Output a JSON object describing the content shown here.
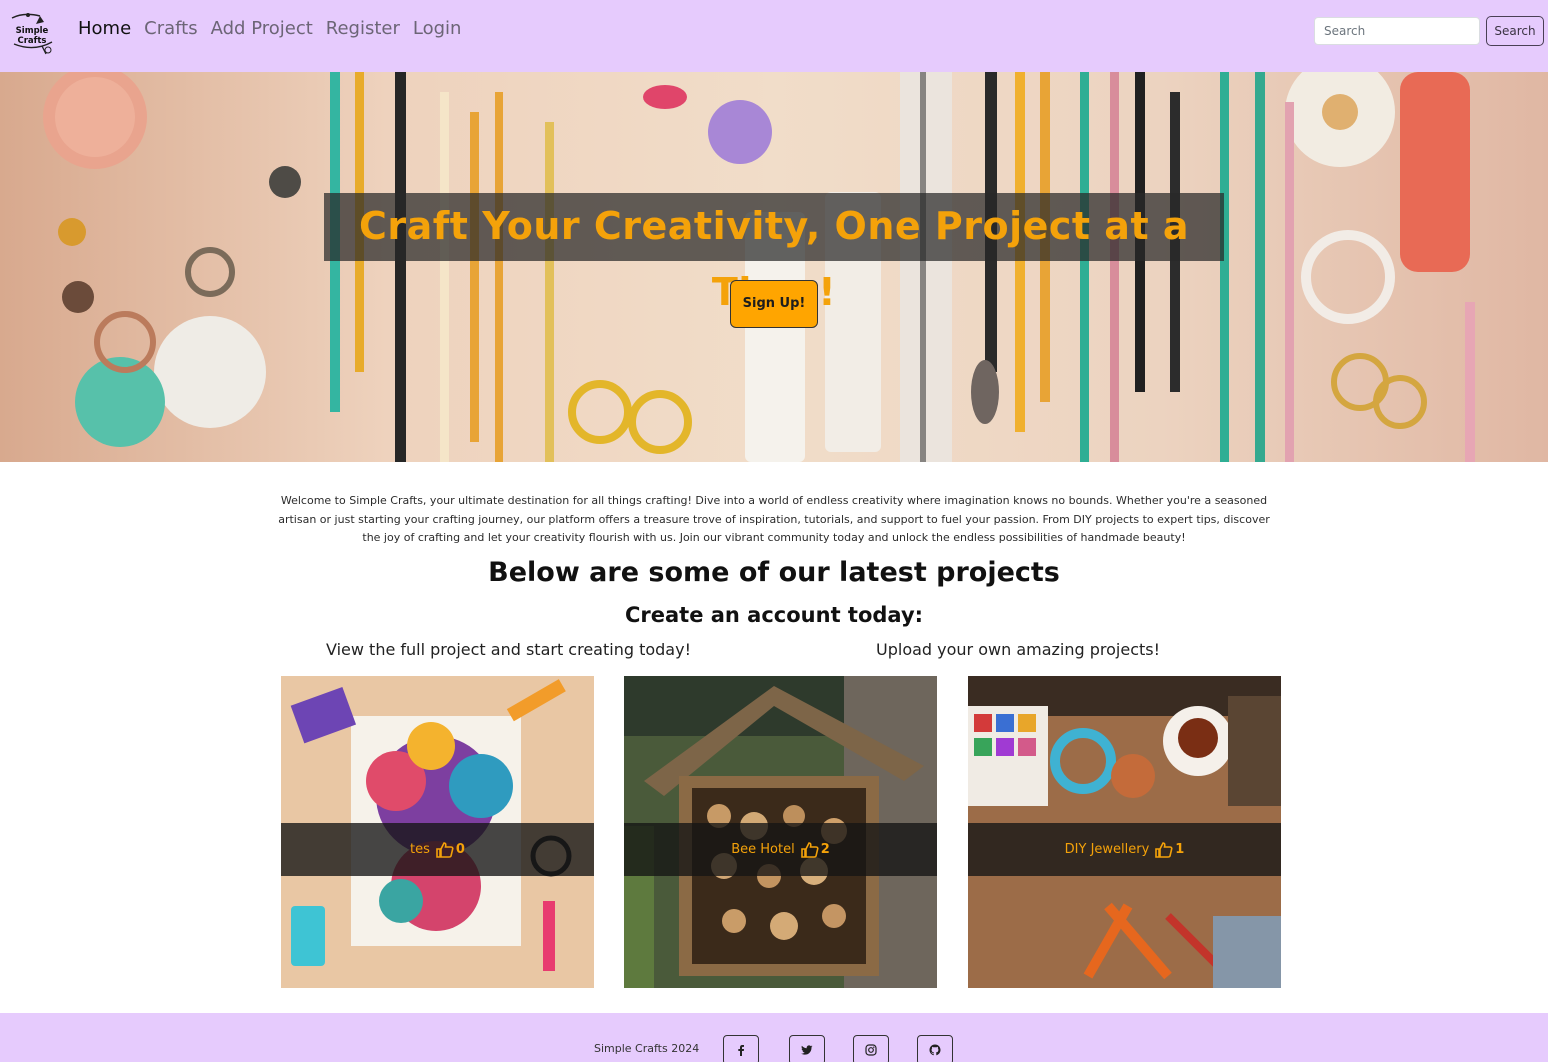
{
  "navbar": {
    "logo_text": "Simple Crafts",
    "links": [
      {
        "label": "Home",
        "active": true
      },
      {
        "label": "Crafts",
        "active": false
      },
      {
        "label": "Add Project",
        "active": false
      },
      {
        "label": "Register",
        "active": false
      },
      {
        "label": "Login",
        "active": false
      }
    ],
    "search_placeholder": "Search",
    "search_button": "Search",
    "background_color": "#e6cbfd"
  },
  "hero": {
    "title": "Craft Your Creativity, One Project at a Time!",
    "cta_label": "Sign Up!",
    "title_color": "#f4a20a",
    "cta_color": "#ffa500"
  },
  "intro": {
    "text": "Welcome to Simple Crafts, your ultimate destination for all things crafting! Dive into a world of endless creativity where imagination knows no bounds. Whether you're a seasoned artisan or just starting your crafting journey, our platform offers a treasure trove of inspiration, tutorials, and support to fuel your passion. From DIY projects to expert tips, discover the joy of crafting and let your creativity flourish with us. Join our vibrant community today and unlock the endless possibilities of handmade beauty!"
  },
  "projects_section": {
    "heading": "Below are some of our latest projects",
    "subheading": "Create an account today:",
    "left_tagline": "View the full project and start creating today!",
    "right_tagline": "Upload your own amazing projects!",
    "cards": [
      {
        "title": "tes",
        "likes": "0",
        "icon": "thumbs-up-icon"
      },
      {
        "title": "Bee Hotel",
        "likes": "2",
        "icon": "thumbs-up-icon"
      },
      {
        "title": "DIY Jewellery",
        "likes": "1",
        "icon": "thumbs-up-icon"
      }
    ]
  },
  "footer": {
    "copyright": "Simple Crafts 2024",
    "social_icons": [
      "facebook-icon",
      "twitter-icon",
      "instagram-icon",
      "github-icon"
    ]
  }
}
